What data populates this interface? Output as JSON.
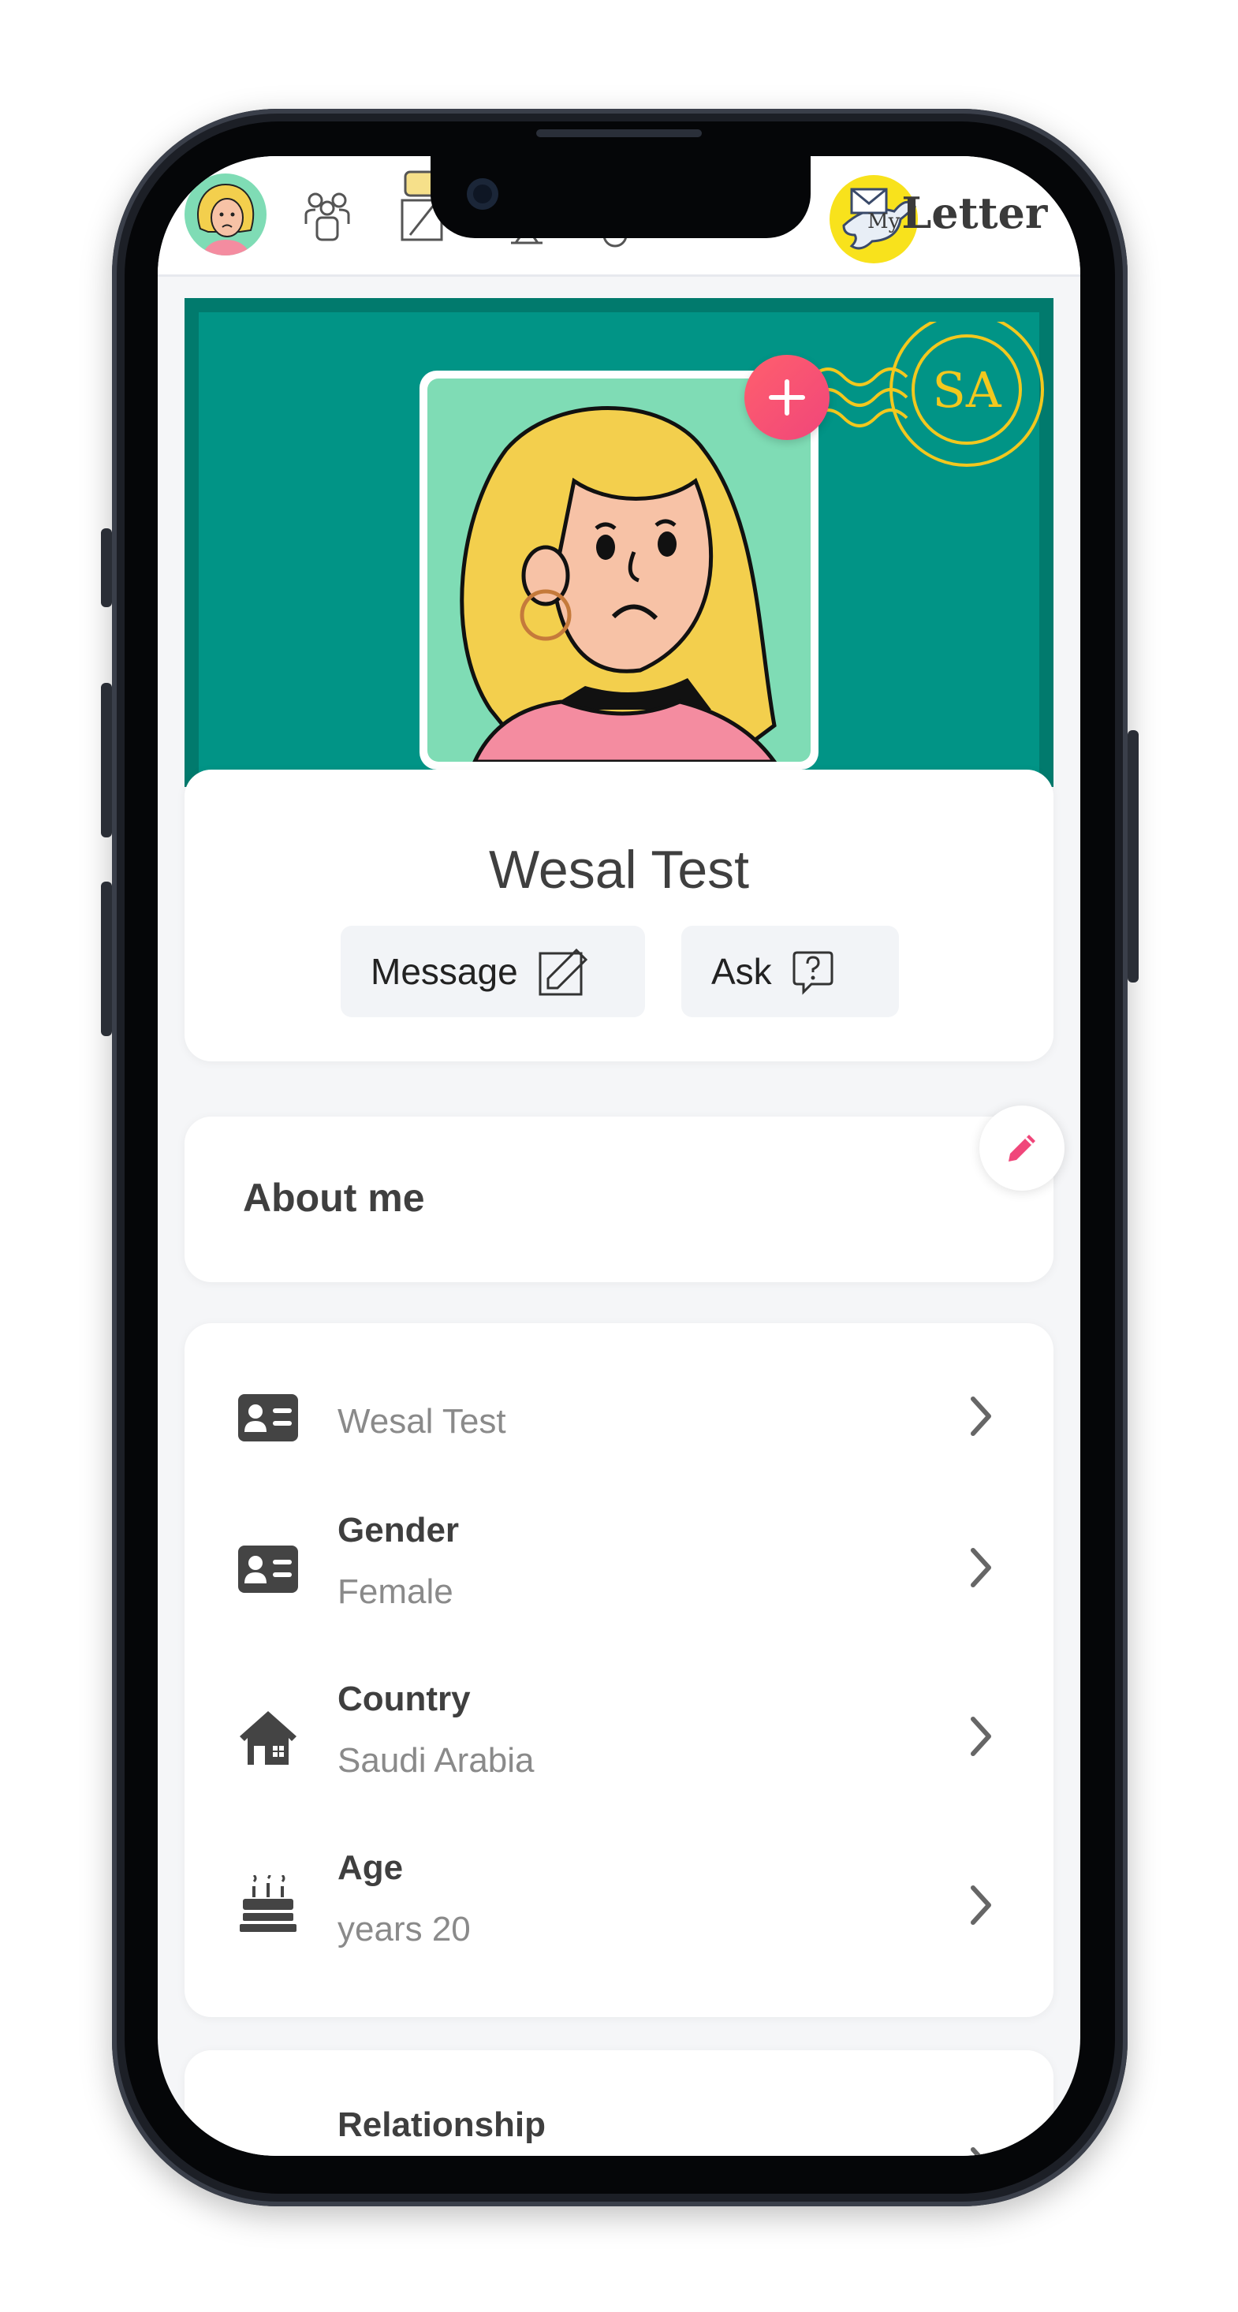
{
  "header": {
    "brand_prefix": "My",
    "brand_name": "Letter"
  },
  "profile": {
    "name": "Wesal Test",
    "message_label": "Message",
    "ask_label": "Ask",
    "stamp_code": "SA"
  },
  "about": {
    "title": "About me"
  },
  "info": {
    "items": [
      {
        "label": "",
        "value": "Wesal Test",
        "icon": "id-card-icon"
      },
      {
        "label": "Gender",
        "value": "Female",
        "icon": "id-card-icon"
      },
      {
        "label": "Country",
        "value": "Saudi Arabia",
        "icon": "house-icon"
      },
      {
        "label": "Age",
        "value": "years 20",
        "icon": "birthday-cake-icon"
      }
    ]
  },
  "relationship": {
    "label": "Relationship"
  },
  "colors": {
    "cover": "#019486",
    "accent": "#f0467a",
    "avatar_bg": "#7fdcb5"
  }
}
